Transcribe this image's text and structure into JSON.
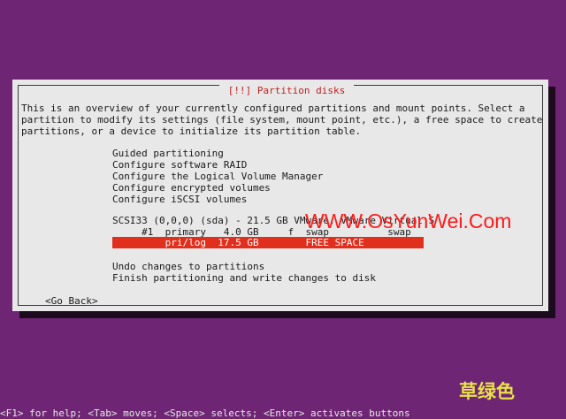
{
  "dialog": {
    "title": "[!!] Partition disks",
    "intro": [
      "This is an overview of your currently configured partitions and mount points. Select a",
      "partition to modify its settings (file system, mount point, etc.), a free space to create",
      "partitions, or a device to initialize its partition table."
    ],
    "options": [
      "Guided partitioning",
      "Configure software RAID",
      "Configure the Logical Volume Manager",
      "Configure encrypted volumes",
      "Configure iSCSI volumes"
    ],
    "disk": "SCSI33 (0,0,0) (sda) - 21.5 GB VMware, VMware Virtual S",
    "partition": "     #1  primary   4.0 GB     f  swap          swap",
    "free_space": "         pri/log  17.5 GB        FREE SPACE",
    "actions": [
      "Undo changes to partitions",
      "Finish partitioning and write changes to disk"
    ],
    "go_back": "<Go Back>"
  },
  "watermark": "WWW.OsYunWei.Com",
  "watermark_cn": "草绿色",
  "footer": "<F1> for help; <Tab> moves; <Space> selects; <Enter> activates buttons",
  "colors": {
    "background": "#6e2574",
    "dialog": "#e8e8e8",
    "highlight": "#e02f1d",
    "title": "#c51e1e"
  }
}
